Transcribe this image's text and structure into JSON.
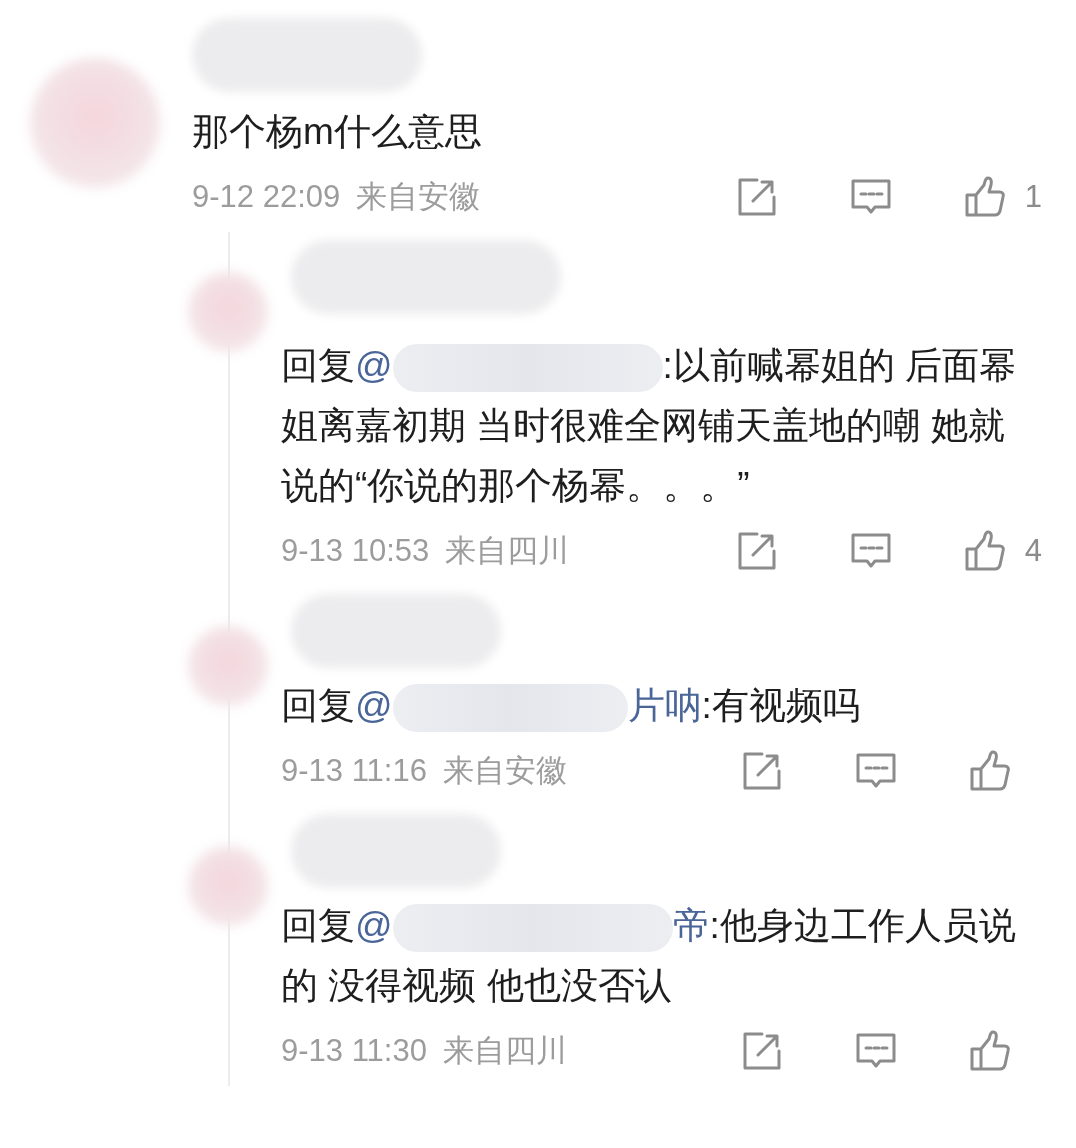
{
  "comment": {
    "text": "那个杨m什么意思",
    "time": "9-12 22:09",
    "location": "来自安徽",
    "likes": "1"
  },
  "replies": [
    {
      "prefix": "回复",
      "mention_start": "@",
      "body": ":以前喊幂姐的 后面幂姐离嘉初期 当时很难全网铺天盖地的嘲 她就说的“你说的那个杨幂。。。”",
      "time": "9-13 10:53",
      "location": "来自四川",
      "likes": "4"
    },
    {
      "prefix": "回复",
      "mention_start": "@",
      "mention_end": "片呐",
      "body": ":有视频吗",
      "time": "9-13 11:16",
      "location": "来自安徽"
    },
    {
      "prefix": "回复",
      "mention_start": "@",
      "mention_end": "帝",
      "body": ":他身边工作人员说的 没得视频 他也没否认",
      "time": "9-13 11:30",
      "location": "来自四川"
    }
  ]
}
